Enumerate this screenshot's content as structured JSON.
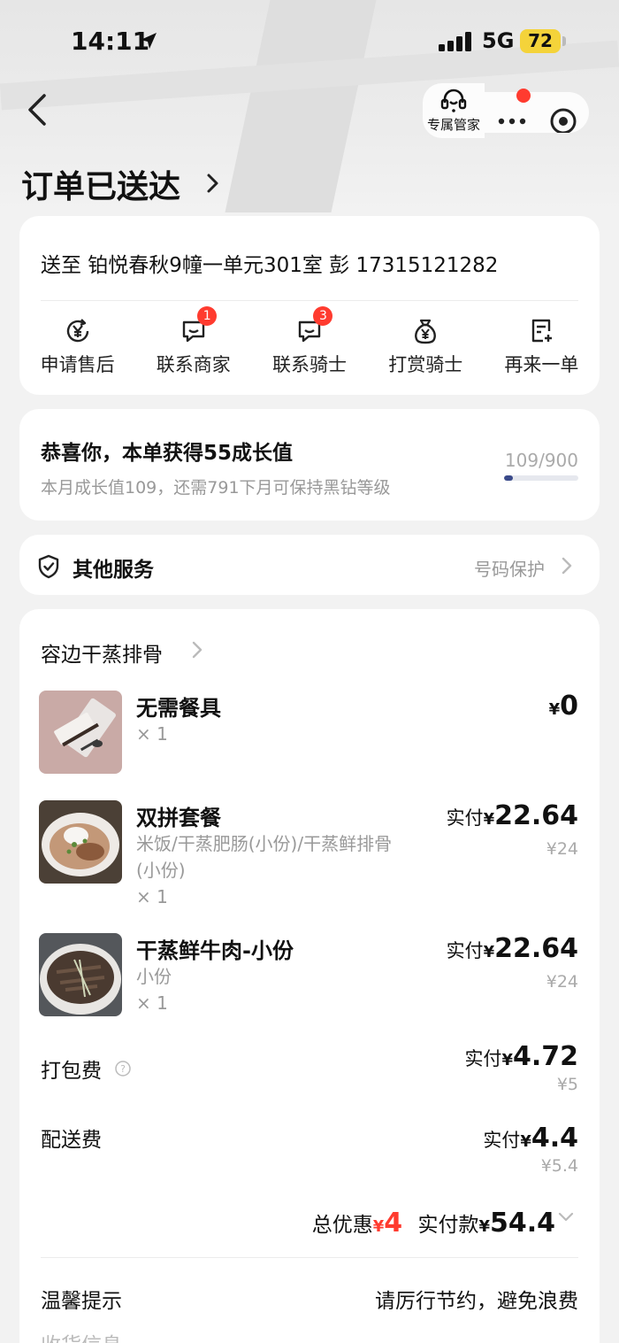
{
  "status_bar": {
    "time": "14:11",
    "network": "5G",
    "battery": "72"
  },
  "nav": {
    "butler_label": "专属管家"
  },
  "page_title": "订单已送达",
  "address": {
    "text": "送至 铂悦春秋9幢一单元301室 彭 17315121282"
  },
  "actions": [
    {
      "label": "申请售后",
      "icon": "yen-refresh-icon",
      "badge": ""
    },
    {
      "label": "联系商家",
      "icon": "chat-icon",
      "badge": "1"
    },
    {
      "label": "联系骑士",
      "icon": "chat-icon",
      "badge": "3"
    },
    {
      "label": "打赏骑士",
      "icon": "money-bag-icon",
      "badge": ""
    },
    {
      "label": "再来一单",
      "icon": "reorder-icon",
      "badge": ""
    }
  ],
  "growth": {
    "title": "恭喜你，本单获得55成长值",
    "subtitle": "本月成长值109，还需791下月可保持黑钻等级",
    "count": "109/900",
    "progress": 0.121
  },
  "service": {
    "title": "其他服务",
    "right": "号码保护"
  },
  "order": {
    "shop_name": "容边干蒸排骨",
    "items": [
      {
        "name": "无需餐具",
        "spec": "",
        "qty": "× 1",
        "pay_prefix": "",
        "yen": "¥",
        "price": "0",
        "original": ""
      },
      {
        "name": "双拼套餐",
        "spec": "米饭/干蒸肥肠(小份)/干蒸鲜排骨(小份)",
        "qty": "× 1",
        "pay_prefix": "实付",
        "yen": "¥",
        "price": "22.64",
        "original": "¥24"
      },
      {
        "name": "干蒸鲜牛肉-小份",
        "spec": "小份",
        "qty": "× 1",
        "pay_prefix": "实付",
        "yen": "¥",
        "price": "22.64",
        "original": "¥24"
      }
    ],
    "packing": {
      "label": "打包费",
      "pay_prefix": "实付",
      "yen": "¥",
      "price": "4.72",
      "original": "¥5"
    },
    "delivery": {
      "label": "配送费",
      "pay_prefix": "实付",
      "yen": "¥",
      "price": "4.4",
      "original": "¥5.4"
    },
    "total": {
      "discount_label": "总优惠",
      "discount_yen": "¥",
      "discount": "4",
      "pay_label": "实付款",
      "pay_yen": "¥",
      "pay": "54.4"
    },
    "tip": {
      "label": "温馨提示",
      "text": "请厉行节约，避免浪费"
    },
    "cut_text": "收货信息"
  },
  "colors": {
    "accent_red": "#ff3b2f",
    "battery_yellow": "#f4d33a",
    "progress_fill": "#3a4a8a"
  }
}
